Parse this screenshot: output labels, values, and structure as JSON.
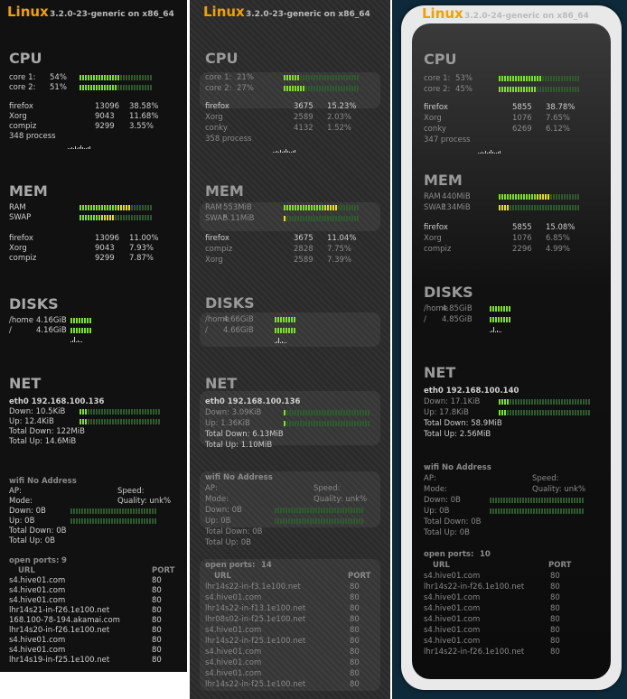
{
  "panels": [
    {
      "header": {
        "logo": "Linux",
        "version": "3.2.0-23-generic on x86_64"
      },
      "cpu": {
        "title": "CPU",
        "cores": [
          {
            "label": "core 1:",
            "value": "54%",
            "level": 0.54
          },
          {
            "label": "core 2:",
            "value": "51%",
            "level": 0.51
          }
        ],
        "procs": [
          {
            "name": "firefox",
            "pid": "13096",
            "pct": "38.58%"
          },
          {
            "name": "Xorg",
            "pid": "9043",
            "pct": "11.68%"
          },
          {
            "name": "compiz",
            "pid": "9299",
            "pct": "3.55%"
          }
        ],
        "count": "348 process"
      },
      "mem": {
        "title": "MEM",
        "rows": [
          {
            "label": "RAM",
            "value": "",
            "level": 0.72
          },
          {
            "label": "SWAP",
            "value": "",
            "level": 0.48
          }
        ],
        "procs": [
          {
            "name": "firefox",
            "pid": "13096",
            "pct": "11.00%"
          },
          {
            "name": "Xorg",
            "pid": "9043",
            "pct": "7.93%"
          },
          {
            "name": "compiz",
            "pid": "9299",
            "pct": "7.87%"
          }
        ]
      },
      "disks": {
        "title": "DISKS",
        "rows": [
          {
            "label": "/home",
            "value": "4.16GiB",
            "level": 0.2
          },
          {
            "label": "/",
            "value": "4.16GiB",
            "level": 0.2
          }
        ]
      },
      "net": {
        "title": "NET",
        "iface": "eth0 192.168.100.136",
        "down": "Down: 10.5KiB",
        "up": "Up: 12.4KiB",
        "total_down": "Total Down: 122MiB",
        "total_up": "Total Up: 14.6MiB",
        "down_level": 0.1,
        "up_level": 0.1
      },
      "wifi": {
        "title": "wifi No Address",
        "ap": "AP:",
        "speed": "Speed:",
        "mode": "Mode:",
        "quality": "Quality: unk%",
        "down": "Down: 0B",
        "up": "Up: 0B",
        "total_down": "Total Down: 0B",
        "total_up": "Total Up: 0B"
      },
      "ports": {
        "title": "open ports:",
        "count": "9",
        "col_url": "URL",
        "col_port": "PORT",
        "rows": [
          {
            "url": "s4.hive01.com",
            "port": "80"
          },
          {
            "url": "s4.hive01.com",
            "port": "80"
          },
          {
            "url": "s4.hive01.com",
            "port": "80"
          },
          {
            "url": "lhr14s21-in-f26.1e100.net",
            "port": "80"
          },
          {
            "url": "168.100-78-194.akamai.com",
            "port": "80"
          },
          {
            "url": "lhr14s20-in-f26.1e100.net",
            "port": "80"
          },
          {
            "url": "s4.hive01.com",
            "port": "80"
          },
          {
            "url": "s4.hive01.com",
            "port": "80"
          },
          {
            "url": "lhr14s19-in-f25.1e100.net",
            "port": "80"
          }
        ]
      }
    },
    {
      "header": {
        "logo": "Linux",
        "version": "3.2.0-23-generic on x86_64"
      },
      "cpu": {
        "title": "CPU",
        "cores": [
          {
            "label": "core 1:",
            "value": "21%",
            "level": 0.21
          },
          {
            "label": "core 2:",
            "value": "27%",
            "level": 0.27
          }
        ],
        "procs": [
          {
            "name": "firefox",
            "pid": "3675",
            "pct": "15.23%"
          },
          {
            "name": "Xorg",
            "pid": "2589",
            "pct": "2.03%"
          },
          {
            "name": "conky",
            "pid": "4132",
            "pct": "1.52%"
          }
        ],
        "count": "358 process"
      },
      "mem": {
        "title": "MEM",
        "rows": [
          {
            "label": "RAM",
            "value": "553MiB",
            "level": 0.7
          },
          {
            "label": "SWAP",
            "value": "5.11MiB",
            "level": 0.05
          }
        ],
        "procs": [
          {
            "name": "firefox",
            "pid": "3675",
            "pct": "11.04%"
          },
          {
            "name": "compiz",
            "pid": "2828",
            "pct": "7.75%"
          },
          {
            "name": "Xorg",
            "pid": "2589",
            "pct": "7.39%"
          }
        ]
      },
      "disks": {
        "title": "DISKS",
        "rows": [
          {
            "label": "/home",
            "value": "4.66GiB",
            "level": 0.15
          },
          {
            "label": "/",
            "value": "4.66GiB",
            "level": 0.15
          }
        ]
      },
      "net": {
        "title": "NET",
        "iface": "eth0 192.168.100.136",
        "down": "Down: 3.09KiB",
        "up": "Up: 1.36KiB",
        "total_down": "Total Down: 6.13MiB",
        "total_up": "Total Up: 1.10MiB",
        "down_level": 0.04,
        "up_level": 0.04
      },
      "wifi": {
        "title": "wifi No Address",
        "ap": "AP:",
        "speed": "Speed:",
        "mode": "Mode:",
        "quality": "Quality: unk%",
        "down": "Down: 0B",
        "up": "Up: 0B",
        "total_down": "Total Down: 0B",
        "total_up": "Total Up: 0B"
      },
      "ports": {
        "title": "open ports:",
        "count": "14",
        "col_url": "URL",
        "col_port": "PORT",
        "rows": [
          {
            "url": "lhr14s22-in-f3.1e100.net",
            "port": "80"
          },
          {
            "url": "s4.hive01.com",
            "port": "80"
          },
          {
            "url": "lhr14s22-in-f13.1e100.net",
            "port": "80"
          },
          {
            "url": "lhr08s02-in-f25.1e100.net",
            "port": "80"
          },
          {
            "url": "s4.hive01.com",
            "port": "80"
          },
          {
            "url": "lhr14s22-in-f25.1e100.net",
            "port": "80"
          },
          {
            "url": "s4.hive01.com",
            "port": "80"
          },
          {
            "url": "s4.hive01.com",
            "port": "80"
          },
          {
            "url": "s4.hive01.com",
            "port": "80"
          },
          {
            "url": "lhr14s22-in-f25.1e100.net",
            "port": "80"
          }
        ]
      }
    },
    {
      "header": {
        "logo": "Linux",
        "version": "3.2.0-24-generic on x86_64"
      },
      "cpu": {
        "title": "CPU",
        "cores": [
          {
            "label": "core 1:",
            "value": "53%",
            "level": 0.53
          },
          {
            "label": "core 2:",
            "value": "45%",
            "level": 0.45
          }
        ],
        "procs": [
          {
            "name": "firefox",
            "pid": "5855",
            "pct": "38.78%"
          },
          {
            "name": "Xorg",
            "pid": "1076",
            "pct": "7.65%"
          },
          {
            "name": "conky",
            "pid": "6269",
            "pct": "6.12%"
          }
        ],
        "count": "347 process"
      },
      "mem": {
        "title": "MEM",
        "rows": [
          {
            "label": "RAM",
            "value": "440MiB",
            "level": 0.62
          },
          {
            "label": "SWAP",
            "value": "134MiB",
            "level": 0.12
          }
        ],
        "procs": [
          {
            "name": "firefox",
            "pid": "5855",
            "pct": "15.08%"
          },
          {
            "name": "Xorg",
            "pid": "1076",
            "pct": "6.85%"
          },
          {
            "name": "compiz",
            "pid": "2296",
            "pct": "4.99%"
          }
        ]
      },
      "disks": {
        "title": "DISKS",
        "rows": [
          {
            "label": "/home",
            "value": "4.85GiB",
            "level": 0.2
          },
          {
            "label": "/",
            "value": "4.85GiB",
            "level": 0.2
          }
        ]
      },
      "net": {
        "title": "NET",
        "iface": "eth0 192.168.100.140",
        "down": "Down: 17.1KiB",
        "up": "Up: 17.8KiB",
        "total_down": "Total Down: 58.9MiB",
        "total_up": "Total Up: 2.56MiB",
        "down_level": 0.12,
        "up_level": 0.1
      },
      "wifi": {
        "title": "wifi No Address",
        "ap": "AP:",
        "speed": "Speed:",
        "mode": "Mode:",
        "quality": "Quality: unk%",
        "down": "Down: 0B",
        "up": "Up: 0B",
        "total_down": "Total Down: 0B",
        "total_up": "Total Up: 0B"
      },
      "ports": {
        "title": "open ports:",
        "count": "10",
        "col_url": "URL",
        "col_port": "PORT",
        "rows": [
          {
            "url": "s4.hive01.com",
            "port": "80"
          },
          {
            "url": "lhr14s22-in-f26.1e100.net",
            "port": "80"
          },
          {
            "url": "s4.hive01.com",
            "port": "80"
          },
          {
            "url": "s4.hive01.com",
            "port": "80"
          },
          {
            "url": "s4.hive01.com",
            "port": "80"
          },
          {
            "url": "s4.hive01.com",
            "port": "80"
          },
          {
            "url": "s4.hive01.com",
            "port": "80"
          },
          {
            "url": "lhr14s22-in-f26.1e100.net",
            "port": "80"
          }
        ]
      }
    }
  ]
}
